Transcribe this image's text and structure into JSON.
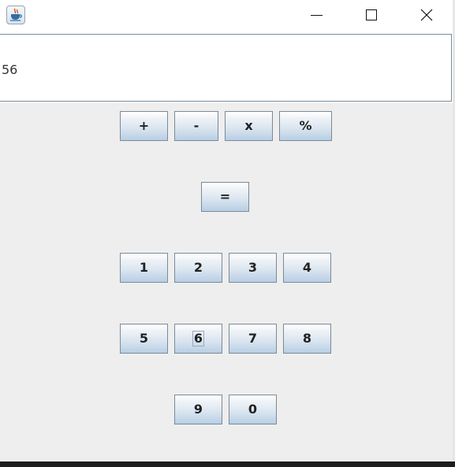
{
  "window": {
    "icon": "java-coffee-cup-icon",
    "controls": [
      "minimize-icon",
      "maximize-icon",
      "close-icon"
    ]
  },
  "display": {
    "value": "56"
  },
  "operators": {
    "plus": "+",
    "minus": "-",
    "multiply": "x",
    "percent": "%",
    "equals": "="
  },
  "digits": {
    "one": "1",
    "two": "2",
    "three": "3",
    "four": "4",
    "five": "5",
    "six": "6",
    "seven": "7",
    "eight": "8",
    "nine": "9",
    "zero": "0"
  },
  "focused_key": "6",
  "colors": {
    "panel": "#eeeeee",
    "button_top": "#ffffff",
    "button_bottom": "#b8cfe5",
    "button_border": "#7a8a99"
  }
}
